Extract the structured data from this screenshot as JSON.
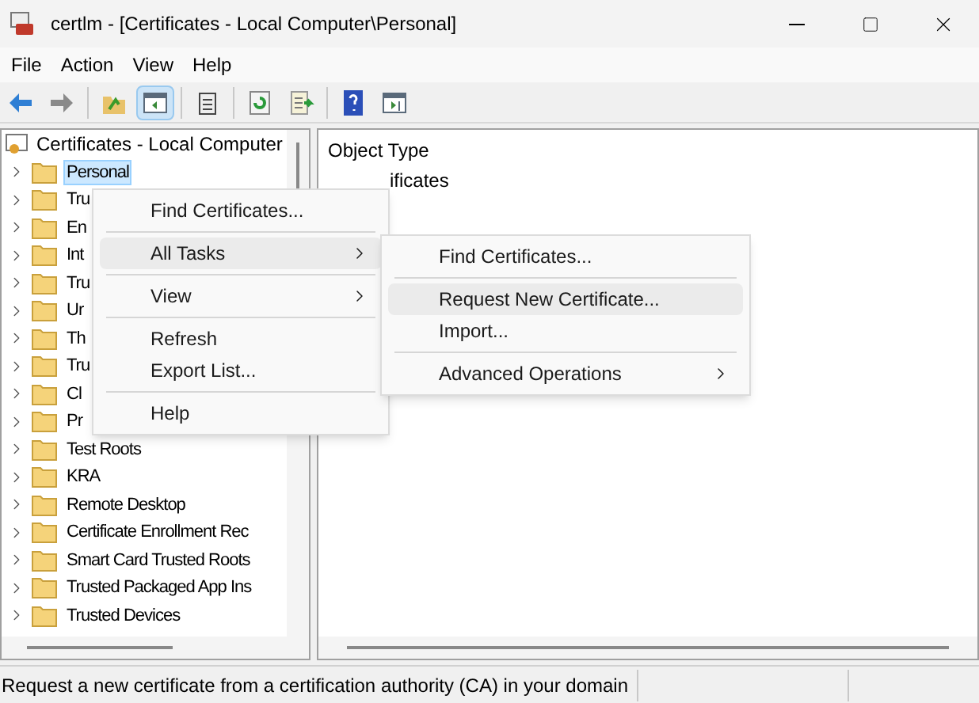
{
  "window": {
    "title": "certlm - [Certificates - Local Computer\\Personal]"
  },
  "menu_bar": [
    "File",
    "Action",
    "View",
    "Help"
  ],
  "toolbar": [
    {
      "kind": "back",
      "disabled": false,
      "pressed": false
    },
    {
      "kind": "forward",
      "disabled": true,
      "pressed": false
    },
    {
      "kind": "sep"
    },
    {
      "kind": "up",
      "pressed": false
    },
    {
      "kind": "tree",
      "pressed": true
    },
    {
      "kind": "sep"
    },
    {
      "kind": "clipboard",
      "pressed": false
    },
    {
      "kind": "sep"
    },
    {
      "kind": "refresh",
      "pressed": false
    },
    {
      "kind": "export",
      "pressed": false
    },
    {
      "kind": "sep"
    },
    {
      "kind": "help",
      "pressed": false
    },
    {
      "kind": "pane",
      "pressed": false
    }
  ],
  "tree": {
    "root": "Certificates - Local Computer",
    "items": [
      {
        "label": "Personal",
        "selected": true
      },
      {
        "label": "Tru",
        "selected": false
      },
      {
        "label": "En",
        "selected": false
      },
      {
        "label": "Int",
        "selected": false
      },
      {
        "label": "Tru",
        "selected": false
      },
      {
        "label": "Ur",
        "selected": false
      },
      {
        "label": "Th",
        "selected": false
      },
      {
        "label": "Tru",
        "selected": false
      },
      {
        "label": "Cl",
        "selected": false
      },
      {
        "label": "Pr",
        "selected": false
      },
      {
        "label": "Test Roots",
        "selected": false
      },
      {
        "label": "KRA",
        "selected": false
      },
      {
        "label": "Remote Desktop",
        "selected": false
      },
      {
        "label": "Certificate Enrollment Rec",
        "selected": false
      },
      {
        "label": "Smart Card Trusted Roots",
        "selected": false
      },
      {
        "label": "Trusted Packaged App Ins",
        "selected": false
      },
      {
        "label": "Trusted Devices",
        "selected": false
      }
    ]
  },
  "list": {
    "column": "Object Type",
    "items": [
      "ificates"
    ]
  },
  "context_menu": [
    {
      "kind": "item",
      "label": "Find Certificates...",
      "submenu": false,
      "selected": false
    },
    {
      "kind": "separator"
    },
    {
      "kind": "item",
      "label": "All Tasks",
      "submenu": true,
      "selected": true
    },
    {
      "kind": "separator"
    },
    {
      "kind": "item",
      "label": "View",
      "submenu": true,
      "selected": false
    },
    {
      "kind": "separator"
    },
    {
      "kind": "item",
      "label": "Refresh",
      "submenu": false,
      "selected": false
    },
    {
      "kind": "item",
      "label": "Export List...",
      "submenu": false,
      "selected": false
    },
    {
      "kind": "separator"
    },
    {
      "kind": "item",
      "label": "Help",
      "submenu": false,
      "selected": false
    }
  ],
  "submenu": [
    {
      "kind": "item",
      "label": "Find Certificates...",
      "submenu": false,
      "selected": false
    },
    {
      "kind": "separator"
    },
    {
      "kind": "item",
      "label": "Request New Certificate...",
      "submenu": false,
      "selected": true
    },
    {
      "kind": "item",
      "label": "Import...",
      "submenu": false,
      "selected": false
    },
    {
      "kind": "separator"
    },
    {
      "kind": "item",
      "label": "Advanced Operations",
      "submenu": true,
      "selected": false
    }
  ],
  "status_bar": "Request a new certificate from a certification authority (CA) in your domain"
}
